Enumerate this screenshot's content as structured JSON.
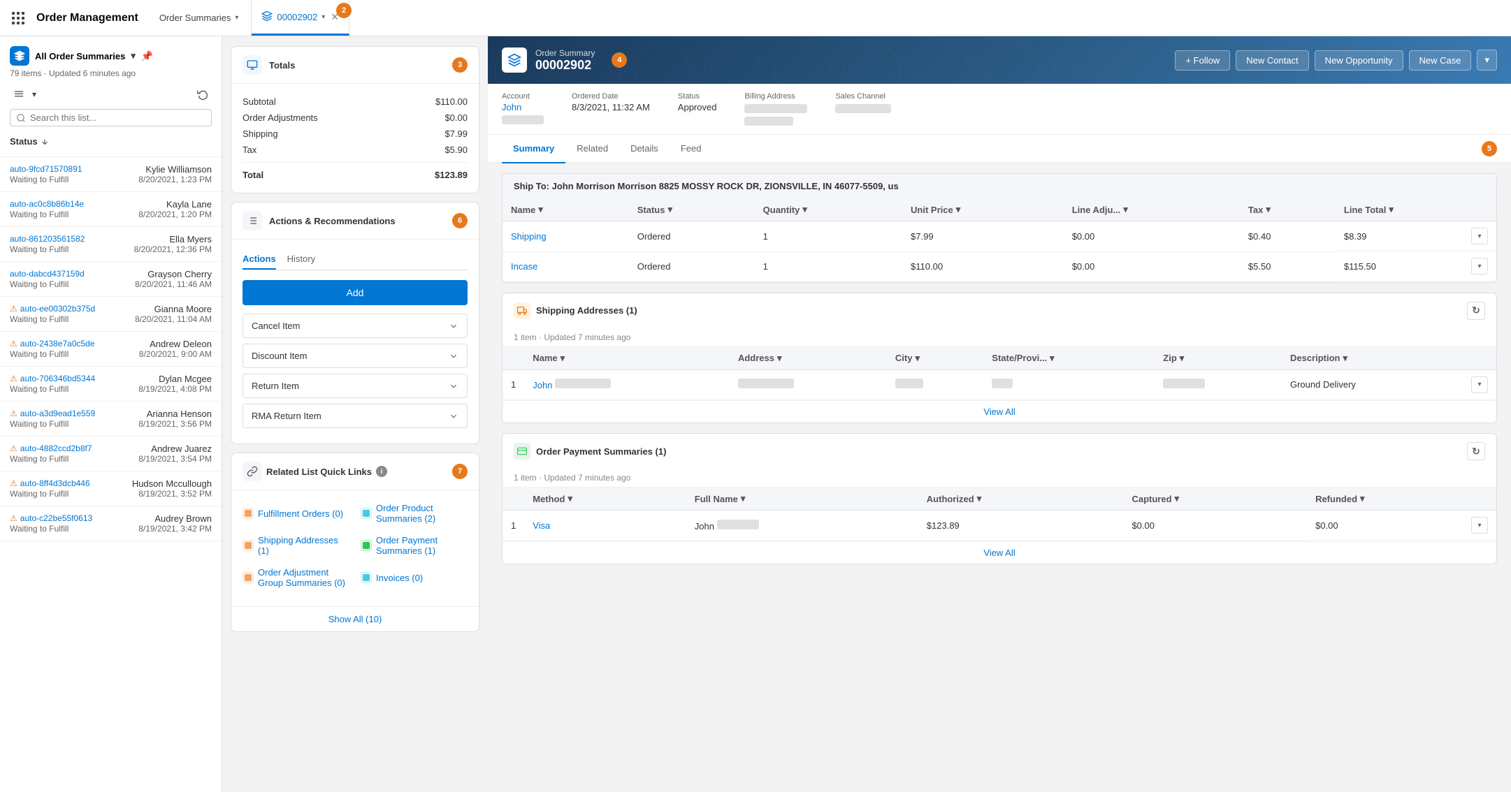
{
  "app": {
    "grid_icon": "grid",
    "title": "Order Management",
    "tabs": [
      {
        "label": "Order Summaries",
        "active": false,
        "badge": null
      },
      {
        "label": "00002902",
        "active": true,
        "badge": "2",
        "icon": "layers"
      }
    ]
  },
  "sidebar": {
    "title": "All Order Summaries",
    "icon": "layers",
    "meta": "79 items · Updated 6 minutes ago",
    "search_placeholder": "Search this list...",
    "sort_label": "Status",
    "items": [
      {
        "id": "auto-9fcd71570891",
        "name": "Kylie Williamson",
        "date": "8/20/2021, 1:23 PM",
        "status": "Waiting to Fulfill",
        "warning": false
      },
      {
        "id": "auto-ac0c8b86b14e",
        "name": "Kayla Lane",
        "date": "8/20/2021, 1:20 PM",
        "status": "Waiting to Fulfill",
        "warning": false
      },
      {
        "id": "auto-861203561582",
        "name": "Ella Myers",
        "date": "8/20/2021, 12:36 PM",
        "status": "Waiting to Fulfill",
        "warning": false
      },
      {
        "id": "auto-dabcd437159d",
        "name": "Grayson Cherry",
        "date": "8/20/2021, 11:46 AM",
        "status": "Waiting to Fulfill",
        "warning": false
      },
      {
        "id": "auto-ee00302b375d",
        "name": "Gianna Moore",
        "date": "8/20/2021, 11:04 AM",
        "status": "Waiting to Fulfill",
        "warning": true
      },
      {
        "id": "auto-2438e7a0c5de",
        "name": "Andrew Deleon",
        "date": "8/20/2021, 9:00 AM",
        "status": "Waiting to Fulfill",
        "warning": true
      },
      {
        "id": "auto-706346bd5344",
        "name": "Dylan Mcgee",
        "date": "8/19/2021, 4:08 PM",
        "status": "Waiting to Fulfill",
        "warning": true
      },
      {
        "id": "auto-a3d9ead1e559",
        "name": "Arianna Henson",
        "date": "8/19/2021, 3:56 PM",
        "status": "Waiting to Fulfill",
        "warning": true
      },
      {
        "id": "auto-4882ccd2b8f7",
        "name": "Andrew Juarez",
        "date": "8/19/2021, 3:54 PM",
        "status": "Waiting to Fulfill",
        "warning": true
      },
      {
        "id": "auto-8ff4d3dcb446",
        "name": "Hudson Mccullough",
        "date": "8/19/2021, 3:52 PM",
        "status": "Waiting to Fulfill",
        "warning": true
      },
      {
        "id": "auto-c22be55f0613",
        "name": "Audrey Brown",
        "date": "8/19/2021, 3:42 PM",
        "status": "Waiting to Fulfill",
        "warning": true
      }
    ]
  },
  "totals": {
    "title": "Totals",
    "rows": [
      {
        "label": "Subtotal",
        "value": "$110.00"
      },
      {
        "label": "Order Adjustments",
        "value": "$0.00"
      },
      {
        "label": "Shipping",
        "value": "$7.99"
      },
      {
        "label": "Tax",
        "value": "$5.90"
      }
    ],
    "total_label": "Total",
    "total_value": "$123.89"
  },
  "actions": {
    "title": "Actions & Recommendations",
    "tabs": [
      "Actions",
      "History"
    ],
    "active_tab": "Actions",
    "add_label": "Add",
    "items": [
      {
        "label": "Cancel Item"
      },
      {
        "label": "Discount Item"
      },
      {
        "label": "Return Item"
      },
      {
        "label": "RMA Return Item"
      }
    ]
  },
  "quicklinks": {
    "title": "Related List Quick Links",
    "items": [
      {
        "label": "Fulfillment Orders (0)",
        "color": "#f4a261"
      },
      {
        "label": "Order Product Summaries (2)",
        "color": "#48cae4"
      },
      {
        "label": "Shipping Addresses (1)",
        "color": "#f4a261"
      },
      {
        "label": "Order Payment Summaries (1)",
        "color": "#2dc653"
      },
      {
        "label": "Order Adjustment Group Summaries (0)",
        "color": "#f4a261"
      },
      {
        "label": "Invoices (0)",
        "color": "#48cae4"
      }
    ],
    "show_all_label": "Show All (10)"
  },
  "order": {
    "subtitle": "Order Summary",
    "number": "00002902",
    "follow_label": "+ Follow",
    "new_contact_label": "New Contact",
    "new_opportunity_label": "New Opportunity",
    "new_case_label": "New Case",
    "account_label": "Account",
    "account_value": "John",
    "ordered_date_label": "Ordered Date",
    "ordered_date_value": "8/3/2021, 11:32 AM",
    "status_label": "Status",
    "status_value": "Approved",
    "billing_address_label": "Billing Address",
    "sales_channel_label": "Sales Channel"
  },
  "tabs": {
    "items": [
      "Summary",
      "Related",
      "Details",
      "Feed"
    ],
    "active": "Summary"
  },
  "order_items": {
    "ship_to": "Ship To: John Morrison Morrison",
    "ship_address": "8825 MOSSY ROCK DR, ZIONSVILLE, IN  46077-5509, us",
    "columns": [
      "Name",
      "Status",
      "Quantity",
      "Unit Price",
      "Line Adju...",
      "Tax",
      "Line Total"
    ],
    "rows": [
      {
        "name": "Shipping",
        "status": "Ordered",
        "quantity": "1",
        "unit_price": "$7.99",
        "line_adj": "$0.00",
        "tax": "$0.40",
        "line_total": "$8.39"
      },
      {
        "name": "Incase",
        "status": "Ordered",
        "quantity": "1",
        "unit_price": "$110.00",
        "line_adj": "$0.00",
        "tax": "$5.50",
        "line_total": "$115.50"
      }
    ]
  },
  "shipping_addresses": {
    "title": "Shipping Addresses (1)",
    "meta": "1 item · Updated 7 minutes ago",
    "columns": [
      "Name",
      "Address",
      "City",
      "State/Provi...",
      "Zip",
      "Description"
    ],
    "rows": [
      {
        "num": "1",
        "name": "John",
        "address": "",
        "city": "",
        "state": "",
        "zip": "",
        "description": "Ground Delivery"
      }
    ],
    "view_all": "View All"
  },
  "payment_summaries": {
    "title": "Order Payment Summaries (1)",
    "meta": "1 item · Updated 7 minutes ago",
    "columns": [
      "Method",
      "Full Name",
      "Authorized",
      "Captured",
      "Refunded"
    ],
    "rows": [
      {
        "num": "1",
        "method": "Visa",
        "full_name": "John",
        "authorized": "$123.89",
        "captured": "$0.00",
        "refunded": "$0.00"
      }
    ],
    "view_all": "View All"
  },
  "badge_numbers": {
    "tab2": "2",
    "badge3": "3",
    "badge4": "4",
    "badge5": "5",
    "badge6": "6",
    "badge7": "7"
  },
  "colors": {
    "primary": "#0176d3",
    "warning": "#e8781a",
    "success": "#2dc653",
    "header_bg": "#1a3a5c"
  }
}
